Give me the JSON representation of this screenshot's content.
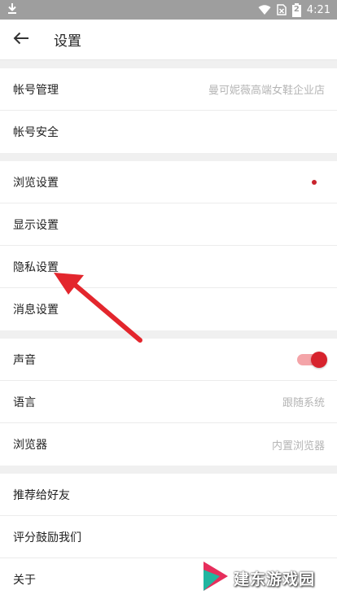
{
  "status": {
    "time": "4:21",
    "battery_level": "2"
  },
  "header": {
    "title": "设置"
  },
  "group1": [
    {
      "label": "帐号管理",
      "value": "曼可妮薇高端女鞋企业店"
    },
    {
      "label": "帐号安全"
    }
  ],
  "group2": [
    {
      "label": "浏览设置"
    },
    {
      "label": "显示设置"
    },
    {
      "label": "隐私设置"
    },
    {
      "label": "消息设置"
    }
  ],
  "group3": [
    {
      "label": "声音"
    },
    {
      "label": "语言",
      "value": "跟随系统"
    },
    {
      "label": "浏览器",
      "value": "内置浏览器"
    }
  ],
  "group4": [
    {
      "label": "推荐给好友"
    },
    {
      "label": "评分鼓励我们"
    },
    {
      "label": "关于"
    }
  ],
  "sound_toggle": {
    "on": true
  },
  "colors": {
    "accent": "#d7232d",
    "status_bar": "#9e9e9e"
  },
  "watermark": {
    "text": "建东游戏园"
  }
}
